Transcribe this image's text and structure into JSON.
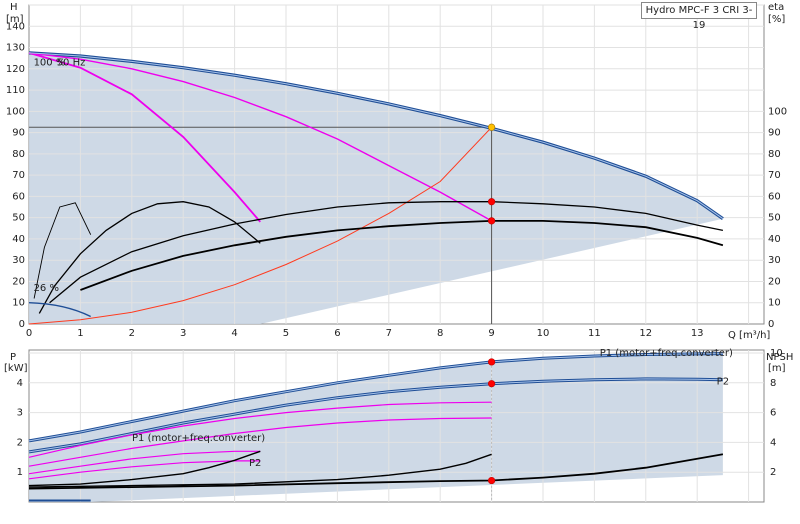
{
  "chart_data": [
    {
      "type": "line",
      "title": "Hydro MPC-F 3 CRI 3-19",
      "ylabel_left": "H",
      "yunit_left": "[m]",
      "ylabel_right": "eta",
      "yunit_right": "[%]",
      "xlabel": "Q [m³/h]",
      "xlim": [
        0,
        14.3
      ],
      "ylim": [
        0,
        150
      ],
      "x_ticks": [
        "0",
        "1",
        "2",
        "3",
        "4",
        "5",
        "6",
        "7",
        "8",
        "9",
        "10",
        "11",
        "12",
        "13"
      ],
      "y_ticks_left": [
        "0",
        "10",
        "20",
        "30",
        "40",
        "50",
        "60",
        "70",
        "80",
        "90",
        "100",
        "110",
        "120",
        "130",
        "140"
      ],
      "y_ticks_right": [
        "0",
        "10",
        "20",
        "30",
        "40",
        "50",
        "60",
        "70",
        "80",
        "90",
        "100"
      ],
      "annotations": [
        {
          "text": "100 %",
          "x": 0.05,
          "y": 123
        },
        {
          "text": "50 Hz",
          "x": 0.5,
          "y": 123
        },
        {
          "text": "26 %",
          "x": 0.05,
          "y": 17
        }
      ],
      "duty_point": {
        "x": 9,
        "y": 92.5
      },
      "grid": true,
      "colors": {
        "head": "#1f4e96",
        "system": "#ff3b1f",
        "magenta": "#ee00ee",
        "efficiency": "#000000",
        "area": "#c9d5e3",
        "duty": "#ffc000"
      },
      "series": [
        {
          "role": "head-max",
          "x": [
            0,
            1,
            2,
            3,
            4,
            5,
            6,
            7,
            8,
            9,
            10,
            11,
            12,
            13,
            13.5
          ],
          "y": [
            127.5,
            126,
            123.5,
            120.5,
            117,
            113,
            108.5,
            103.5,
            98,
            92,
            85.5,
            78,
            69.5,
            58,
            49.5
          ]
        },
        {
          "role": "head-single",
          "x": [
            0,
            1,
            2,
            3,
            4,
            4.5
          ],
          "y": [
            127.5,
            120.5,
            108,
            88,
            62,
            48
          ]
        },
        {
          "role": "head-double",
          "x": [
            0,
            1,
            2,
            3,
            4,
            5,
            6,
            7,
            8,
            9
          ],
          "y": [
            127.5,
            124.5,
            120,
            114,
            106.5,
            97.5,
            87,
            74.5,
            62,
            48.5
          ]
        },
        {
          "role": "system",
          "x": [
            0,
            1,
            2,
            3,
            4,
            5,
            6,
            7,
            8,
            9
          ],
          "y": [
            0,
            2,
            5.5,
            11,
            18.5,
            28,
            39,
            52,
            67,
            92.5
          ]
        },
        {
          "role": "eta-1",
          "x": [
            0.2,
            0.5,
            1,
            1.5,
            2,
            2.5,
            3,
            3.5,
            4,
            4.5
          ],
          "y": [
            5,
            18,
            33,
            44,
            52,
            56.5,
            57.5,
            55,
            48,
            38
          ]
        },
        {
          "role": "eta-2",
          "x": [
            0.4,
            1,
            2,
            3,
            4,
            5,
            6,
            7,
            8,
            9,
            10,
            11,
            12,
            13,
            13.5
          ],
          "y": [
            10,
            22,
            34,
            41.5,
            47,
            51.5,
            55,
            57,
            57.5,
            57.5,
            56.5,
            55,
            52,
            46.5,
            44
          ]
        },
        {
          "role": "eta-3",
          "x": [
            1,
            2,
            3,
            4,
            5,
            6,
            7,
            8,
            9,
            10,
            11,
            12,
            13,
            13.5
          ],
          "y": [
            16,
            25,
            32,
            37,
            41,
            44,
            46,
            47.5,
            48.5,
            48.5,
            47.5,
            45.5,
            40.5,
            37
          ]
        },
        {
          "role": "eta-low",
          "x": [
            0.1,
            0.3,
            0.6,
            0.9,
            1.2
          ],
          "y": [
            12,
            36,
            55,
            57,
            42
          ]
        }
      ],
      "duty_markers": [
        {
          "x": 9,
          "y": 92.5,
          "color": "#ffc000"
        },
        {
          "x": 9,
          "y": 57.5,
          "color": "#ff0000"
        },
        {
          "x": 9,
          "y": 48.5,
          "color": "#ff0000"
        }
      ]
    },
    {
      "type": "line",
      "ylabel_left": "P",
      "yunit_left": "[kW]",
      "ylabel_right": "NPSH",
      "yunit_right": "[m]",
      "xlim": [
        0,
        14.3
      ],
      "ylim": [
        0,
        5.1
      ],
      "y_ticks_left": [
        "1",
        "2",
        "3",
        "4"
      ],
      "y_ticks_right": [
        "2",
        "4",
        "6",
        "8",
        "10"
      ],
      "labels": [
        {
          "text": "P1 (motor+freq.converter)",
          "x": 12.4,
          "y": 4.9
        },
        {
          "text": "P2",
          "x": 13.5,
          "y": 3.95
        },
        {
          "text": "P1 (motor+freq.converter)",
          "x": 3.3,
          "y": 2.05
        },
        {
          "text": "P2",
          "x": 4.4,
          "y": 1.2
        }
      ],
      "series": [
        {
          "role": "p1-max",
          "x": [
            0,
            1,
            2,
            3,
            4,
            5,
            6,
            7,
            8,
            9,
            10,
            11,
            12,
            13,
            13.5
          ],
          "y": [
            2.05,
            2.35,
            2.7,
            3.05,
            3.4,
            3.7,
            4.0,
            4.25,
            4.5,
            4.7,
            4.82,
            4.9,
            4.95,
            4.97,
            4.98
          ]
        },
        {
          "role": "p2-max",
          "x": [
            0,
            1,
            2,
            3,
            4,
            5,
            6,
            7,
            8,
            9,
            10,
            11,
            12,
            13,
            13.5
          ],
          "y": [
            1.68,
            1.95,
            2.3,
            2.65,
            2.95,
            3.25,
            3.5,
            3.7,
            3.85,
            3.97,
            4.05,
            4.1,
            4.13,
            4.12,
            4.1
          ]
        },
        {
          "role": "p1-double",
          "x": [
            0,
            1,
            2,
            3,
            4,
            5,
            6,
            7,
            8,
            9
          ],
          "y": [
            1.5,
            1.9,
            2.25,
            2.55,
            2.8,
            3.0,
            3.15,
            3.27,
            3.33,
            3.35
          ]
        },
        {
          "role": "p2-double",
          "x": [
            0,
            1,
            2,
            3,
            4,
            5,
            6,
            7,
            8,
            9
          ],
          "y": [
            1.2,
            1.5,
            1.8,
            2.05,
            2.3,
            2.5,
            2.65,
            2.75,
            2.8,
            2.82
          ]
        },
        {
          "role": "p1-single",
          "x": [
            0,
            1,
            2,
            3,
            4,
            4.5
          ],
          "y": [
            0.95,
            1.2,
            1.45,
            1.62,
            1.7,
            1.7
          ]
        },
        {
          "role": "p2-single",
          "x": [
            0,
            1,
            2,
            3,
            4,
            4.5
          ],
          "y": [
            0.78,
            1.0,
            1.18,
            1.32,
            1.38,
            1.38
          ]
        },
        {
          "role": "npsh-single",
          "x": [
            0,
            1,
            2,
            3,
            3.5,
            4,
            4.5
          ],
          "y": [
            0.55,
            0.6,
            0.75,
            0.95,
            1.15,
            1.4,
            1.7
          ]
        },
        {
          "role": "npsh-double",
          "x": [
            0,
            2,
            4,
            6,
            7,
            8,
            8.5,
            9
          ],
          "y": [
            0.5,
            0.55,
            0.6,
            0.75,
            0.9,
            1.1,
            1.3,
            1.6
          ]
        },
        {
          "role": "npsh-max",
          "x": [
            0,
            2,
            4,
            6,
            8,
            9,
            10,
            11,
            12,
            13,
            13.5
          ],
          "y": [
            0.45,
            0.5,
            0.55,
            0.63,
            0.7,
            0.72,
            0.82,
            0.95,
            1.15,
            1.45,
            1.6
          ]
        }
      ],
      "duty_markers": [
        {
          "x": 9,
          "y": 4.7,
          "color": "#ff0000"
        },
        {
          "x": 9,
          "y": 3.97,
          "color": "#ff0000"
        },
        {
          "x": 9,
          "y": 0.72,
          "color": "#ff0000"
        }
      ]
    }
  ]
}
